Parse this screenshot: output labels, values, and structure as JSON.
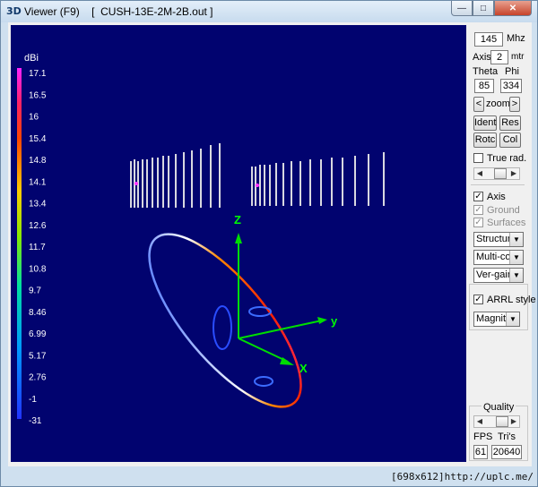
{
  "window": {
    "title_icon": "3D",
    "title": "Viewer (F9)    [  CUSH-13E-2M-2B.out ]",
    "controls": {
      "minimize": "—",
      "maximize": "□",
      "close": "✕"
    }
  },
  "colorbar": {
    "unit": "dBi",
    "ticks": [
      "17.1",
      "16.5",
      "16",
      "15.4",
      "14.8",
      "14.1",
      "13.4",
      "12.6",
      "11.7",
      "10.8",
      "9.7",
      "8.46",
      "6.99",
      "5.17",
      "2.76",
      "-1",
      "-31"
    ]
  },
  "axes3d": {
    "z": "Z",
    "y": "y",
    "x": "X"
  },
  "panel": {
    "freq_value": "145",
    "freq_unit": "Mhz",
    "axis_label": "Axis",
    "axis_value": "2",
    "axis_unit": "mtr",
    "theta_label": "Theta",
    "phi_label": "Phi",
    "theta_value": "85",
    "phi_value": "334",
    "zoom_left": "<",
    "zoom_label": "zoom",
    "zoom_right": ">",
    "ident": "Ident",
    "res": "Res",
    "rotc": "Rotc",
    "col": "Col",
    "true_rad": "True rad.",
    "axis_chk": "Axis",
    "ground_chk": "Ground",
    "surfaces_chk": "Surfaces",
    "structure_sel": "Structure",
    "multicolor_sel": "Multi-colo",
    "vergain_sel": "Ver-gain",
    "arrl_chk": "ARRL style",
    "magnitude_sel": "Magnitud",
    "quality_label": "Quality",
    "fps_label": "FPS",
    "tris_label": "Tri's",
    "fps_value": "61",
    "tris_value": "20640"
  },
  "status": {
    "text": "[698x612]http://uplc.me/"
  }
}
